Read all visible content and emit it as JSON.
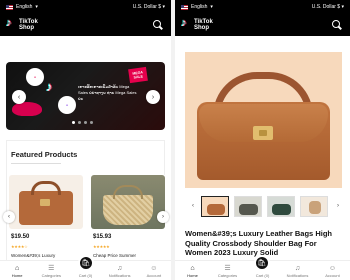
{
  "left": {
    "topbar": {
      "language": "English",
      "currency": "U.S. Dollar $"
    },
    "header": {
      "logo_line1": "TikTok",
      "logo_line2": "Shop"
    },
    "banner": {
      "promo_text": "ເກາະລີ້ກເກາະເພີ້ມສຳລັບ Mega Sales ບໍ່ນຳທາງນ ທ່ານ Mega Sales ບໍ່ນ",
      "badge_text": "MEGA SALE",
      "slide_dots": 4,
      "active_dot": 0
    },
    "featured": {
      "title": "Featured Products",
      "products": [
        {
          "price": "$19.50",
          "stars": "★★★★☆",
          "name": "Women&#39;s Luxury"
        },
        {
          "price": "$15.93",
          "stars": "★★★★★",
          "name": "Cheap Price Summer"
        }
      ]
    },
    "bottom_nav": [
      {
        "label": "Home",
        "icon": "home-icon",
        "glyph": "⌂"
      },
      {
        "label": "Categories",
        "icon": "grid-icon",
        "glyph": "☰"
      },
      {
        "label": "Cart (0)",
        "icon": "cart-icon",
        "glyph": ""
      },
      {
        "label": "Notifications",
        "icon": "bell-icon",
        "glyph": "♫"
      },
      {
        "label": "Account",
        "icon": "user-icon",
        "glyph": "☺"
      }
    ]
  },
  "right": {
    "topbar": {
      "language": "English",
      "currency": "U.S. Dollar $"
    },
    "header": {
      "logo_line1": "TikTok",
      "logo_line2": "Shop"
    },
    "product": {
      "title": "Women&#39;s Luxury Leather Bags High Quality Crossbody Shoulder Bag For Women 2023 Luxury Solid",
      "thumbnail_count": 4,
      "active_thumbnail": 0
    },
    "bottom_nav": [
      {
        "label": "Home",
        "icon": "home-icon",
        "glyph": "⌂"
      },
      {
        "label": "Categories",
        "icon": "grid-icon",
        "glyph": "☰"
      },
      {
        "label": "Cart (0)",
        "icon": "cart-icon",
        "glyph": ""
      },
      {
        "label": "Notifications",
        "icon": "bell-icon",
        "glyph": "♫"
      },
      {
        "label": "Account",
        "icon": "user-icon",
        "glyph": "☺"
      }
    ]
  },
  "colors": {
    "header_bg": "#000000",
    "price": "#111111",
    "stars": "#f5a623",
    "bag_brown": "#b4693a"
  }
}
